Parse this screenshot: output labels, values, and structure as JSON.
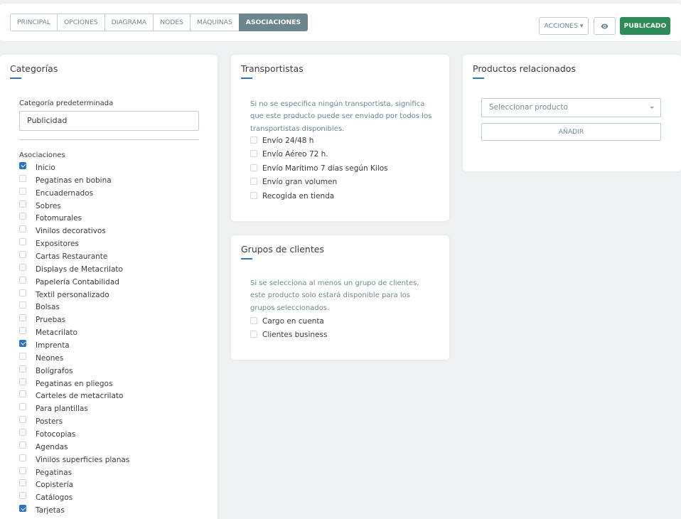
{
  "tabs": [
    {
      "label": "Principal"
    },
    {
      "label": "Opciones"
    },
    {
      "label": "Diagrama"
    },
    {
      "label": "Nodes"
    },
    {
      "label": "Máquinas"
    },
    {
      "label": "Asociaciones",
      "active": true
    }
  ],
  "toolbar": {
    "actions_label": "ACCIONES ▾",
    "preview_icon": "eye-icon",
    "publish_label": "PUBLICADO"
  },
  "colors": {
    "accent": "#2d74c4",
    "publish": "#2d8b57",
    "active_tab": "#6c868e"
  },
  "categorias": {
    "title": "Categorías",
    "default_label": "Categoría predeterminada",
    "default_value": "Publicidad",
    "assoc_label": "Asociaciones",
    "items": [
      {
        "label": "Inicio",
        "checked": true
      },
      {
        "label": "Pegatinas en bobina",
        "checked": false
      },
      {
        "label": "Encuadernados",
        "checked": false
      },
      {
        "label": "Sobres",
        "checked": false
      },
      {
        "label": "Fotomurales",
        "checked": false
      },
      {
        "label": "Vinilos decorativos",
        "checked": false
      },
      {
        "label": "Expositores",
        "checked": false
      },
      {
        "label": "Cartas Restaurante",
        "checked": false
      },
      {
        "label": "Displays de Metacrilato",
        "checked": false
      },
      {
        "label": "Papelería Contabilidad",
        "checked": false
      },
      {
        "label": "Textil personalizado",
        "checked": false
      },
      {
        "label": "Bolsas",
        "checked": false
      },
      {
        "label": "Pruebas",
        "checked": false
      },
      {
        "label": "Metacrilato",
        "checked": false
      },
      {
        "label": "Imprenta",
        "checked": true
      },
      {
        "label": "Neones",
        "checked": false
      },
      {
        "label": "Bolígrafos",
        "checked": false
      },
      {
        "label": "Pegatinas en pliegos",
        "checked": false
      },
      {
        "label": "Carteles de metacrilato",
        "checked": false
      },
      {
        "label": "Para plantillas",
        "checked": false
      },
      {
        "label": "Posters",
        "checked": false
      },
      {
        "label": "Fotocopias",
        "checked": false
      },
      {
        "label": "Agendas",
        "checked": false
      },
      {
        "label": "Vinilos superficies planas",
        "checked": false
      },
      {
        "label": "Pegatinas",
        "checked": false
      },
      {
        "label": "Copistería",
        "checked": false
      },
      {
        "label": "Catálogos",
        "checked": false
      },
      {
        "label": "Tarjetas",
        "checked": true
      }
    ]
  },
  "transportistas": {
    "title": "Transportistas",
    "description": "Si no se especifica ningún transportista, significa que este producto puede ser enviado por todos los transportistas disponibles.",
    "items": [
      {
        "label": "Envío 24/48 h",
        "checked": false
      },
      {
        "label": "Envío Aéreo 72 h.",
        "checked": false
      },
      {
        "label": "Envío Marítimo 7 días según Kilos",
        "checked": false
      },
      {
        "label": "Envío gran volumen",
        "checked": false
      },
      {
        "label": "Recogida en tienda",
        "checked": false
      }
    ]
  },
  "grupos": {
    "title": "Grupos de clientes",
    "description": "Si se selecciona al menos un grupo de clientes, este producto solo estará disponible para los grupos seleccionados.",
    "items": [
      {
        "label": "Cargo en cuenta",
        "checked": false
      },
      {
        "label": "Clientes business",
        "checked": false
      }
    ]
  },
  "productos": {
    "title": "Productos relacionados",
    "select_placeholder": "Seleccionar producto",
    "add_label": "AÑADIR"
  }
}
